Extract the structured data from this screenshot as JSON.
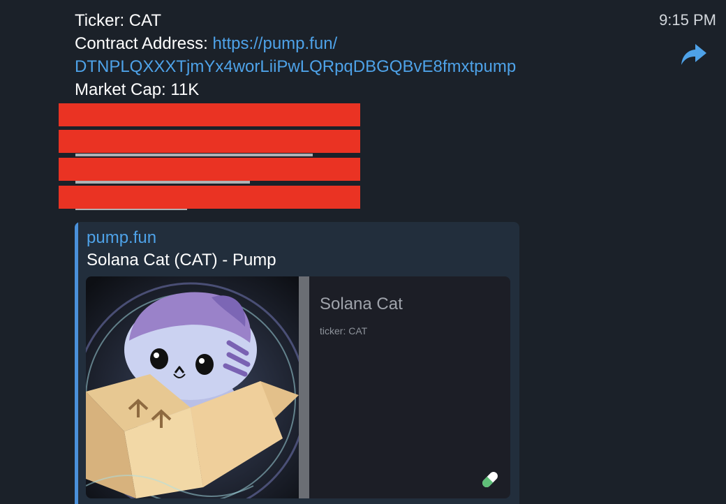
{
  "message": {
    "ticker_line": "Ticker: CAT",
    "contract_label": "Contract Address: ",
    "contract_link_part1": "https://pump.fun/",
    "contract_link_part2": "DTNPLQXXXTjmYx4worLiiPwLQRpqDBGQBvE8fmxtpump",
    "market_cap_line": "Market Cap: 11K"
  },
  "time": "9:15 PM",
  "forward_icon": "forward-arrow-icon",
  "redaction_color": "#ea3323",
  "preview": {
    "site": "pump.fun",
    "title": "Solana Cat (CAT) - Pump",
    "card_name": "Solana Cat",
    "card_ticker": "ticker: CAT",
    "pill_icon": "pill-icon"
  },
  "colors": {
    "background": "#1b2129",
    "link": "#4ea2e8",
    "preview_bar": "#4a90d9",
    "preview_bg": "#222e3c"
  }
}
